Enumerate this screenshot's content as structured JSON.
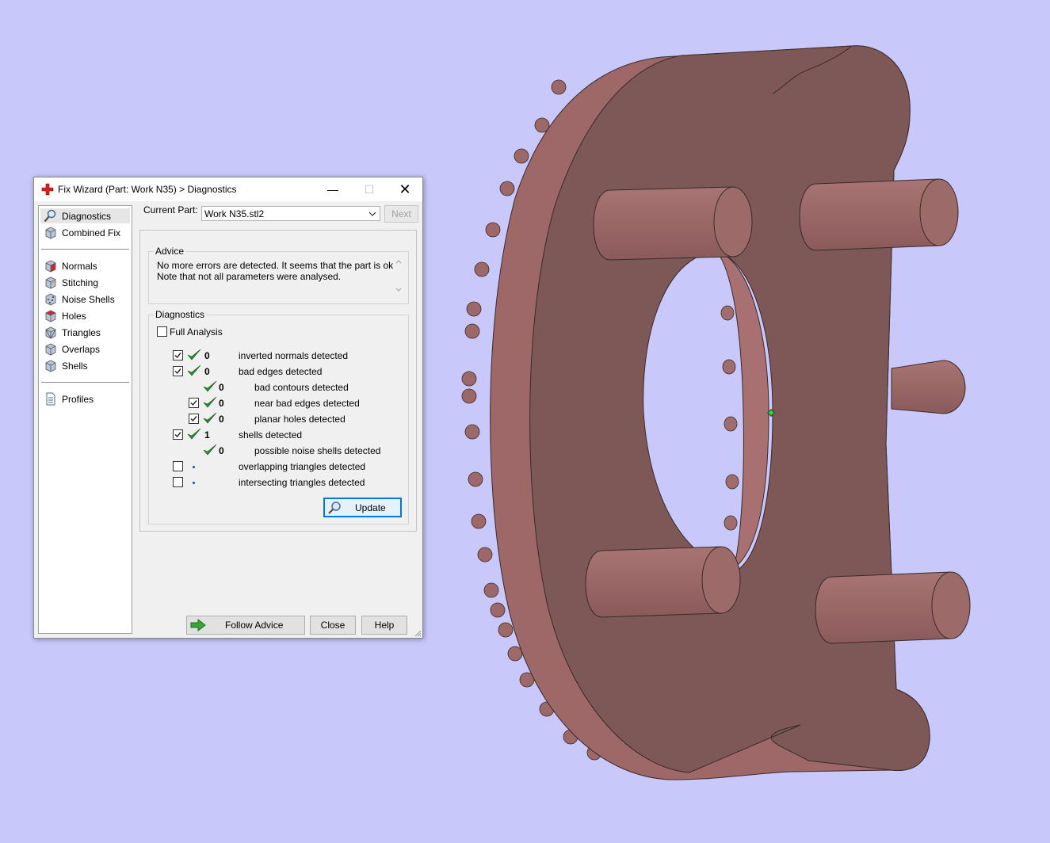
{
  "window": {
    "title": "Fix Wizard (Part: Work N35) > Diagnostics",
    "minimize_glyph": "—",
    "maximize_glyph": "☐",
    "close_glyph": "✕"
  },
  "sidebar": {
    "items": [
      {
        "label": "Diagnostics",
        "icon": "magnifier-icon",
        "selected": true
      },
      {
        "label": "Combined Fix",
        "icon": "cube-icon"
      },
      {
        "label": "Normals",
        "icon": "cube-red-icon"
      },
      {
        "label": "Stitching",
        "icon": "cube-icon"
      },
      {
        "label": "Noise Shells",
        "icon": "noise-cube-icon"
      },
      {
        "label": "Holes",
        "icon": "cube-red-icon"
      },
      {
        "label": "Triangles",
        "icon": "cube-triangle-icon"
      },
      {
        "label": "Overlaps",
        "icon": "cube-icon"
      },
      {
        "label": "Shells",
        "icon": "cube-icon"
      },
      {
        "label": "Profiles",
        "icon": "document-icon"
      }
    ]
  },
  "current_part": {
    "label": "Current Part:",
    "value": "Work N35.stl2",
    "next_label": "Next"
  },
  "advice": {
    "title": "Advice",
    "line1": "No more errors are detected. It seems that the part is ok.",
    "line2": "Note that not all parameters were analysed."
  },
  "diagnostics": {
    "title": "Diagnostics",
    "full_analysis_label": "Full Analysis",
    "rows": [
      {
        "checked": true,
        "ok": true,
        "count": "0",
        "text": "inverted normals detected"
      },
      {
        "checked": true,
        "ok": true,
        "count": "0",
        "text": "bad edges detected"
      },
      {
        "ok": true,
        "count": "0",
        "text": "bad contours detected"
      },
      {
        "checked": true,
        "ok": true,
        "count": "0",
        "text": "near bad edges detected"
      },
      {
        "checked": true,
        "ok": true,
        "count": "0",
        "text": "planar holes detected"
      },
      {
        "checked": true,
        "ok": true,
        "count": "1",
        "text": "shells detected"
      },
      {
        "ok": true,
        "count": "0",
        "text": "possible noise shells detected"
      },
      {
        "checked": false,
        "ok": false,
        "count": "",
        "text": "overlapping triangles detected"
      },
      {
        "checked": false,
        "ok": false,
        "count": "",
        "text": "intersecting triangles detected"
      }
    ],
    "update_label": "Update"
  },
  "footer": {
    "follow_advice_label": "Follow Advice",
    "close_label": "Close",
    "help_label": "Help"
  },
  "colors": {
    "viewport_bg": "#c8c8fa",
    "part_top": "#7e5757",
    "part_side": "#a06a6a",
    "check_green": "#2e8b2e",
    "accent_blue": "#0078d7"
  }
}
